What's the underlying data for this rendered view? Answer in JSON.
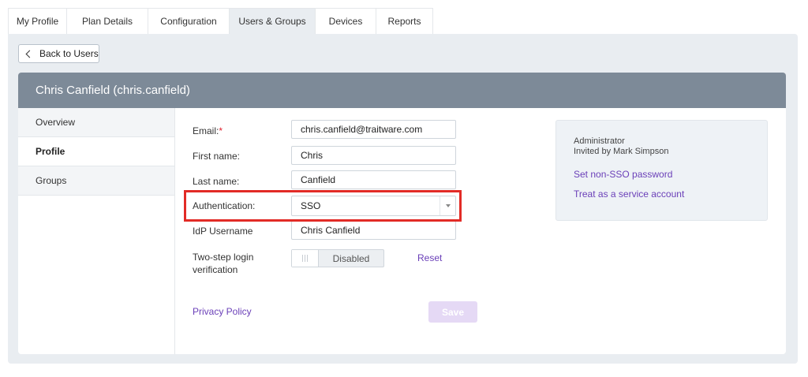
{
  "tabs": [
    {
      "label": "My Profile"
    },
    {
      "label": "Plan Details"
    },
    {
      "label": "Configuration"
    },
    {
      "label": "Users & Groups",
      "active": true
    },
    {
      "label": "Devices"
    },
    {
      "label": "Reports"
    }
  ],
  "back_button": {
    "label": "Back to Users"
  },
  "header": {
    "title": "Chris Canfield (chris.canfield)"
  },
  "sidebar": {
    "items": [
      {
        "label": "Overview"
      },
      {
        "label": "Profile",
        "active": true
      },
      {
        "label": "Groups"
      }
    ]
  },
  "form": {
    "email": {
      "label": "Email:",
      "required_mark": "*",
      "value": "chris.canfield@traitware.com"
    },
    "first_name": {
      "label": "First name:",
      "value": "Chris"
    },
    "last_name": {
      "label": "Last name:",
      "value": "Canfield"
    },
    "authentication": {
      "label": "Authentication:",
      "value": "SSO"
    },
    "idp_username": {
      "label": "IdP Username",
      "value": "Chris Canfield"
    },
    "two_step": {
      "label_line1": "Two-step login",
      "label_line2": "verification",
      "state": "Disabled",
      "reset_label": "Reset"
    },
    "privacy_policy": "Privacy Policy",
    "save_label": "Save"
  },
  "info_panel": {
    "role": "Administrator",
    "invited_by": "Invited by Mark Simpson",
    "set_password_link": "Set non-SSO password",
    "service_account_link": "Treat as a service account"
  },
  "colors": {
    "header_bg": "#7d8a98",
    "link": "#6a3fb8",
    "highlight": "#e22b26",
    "save_disabled": "#e5d9f5",
    "required": "#e01e2b"
  }
}
